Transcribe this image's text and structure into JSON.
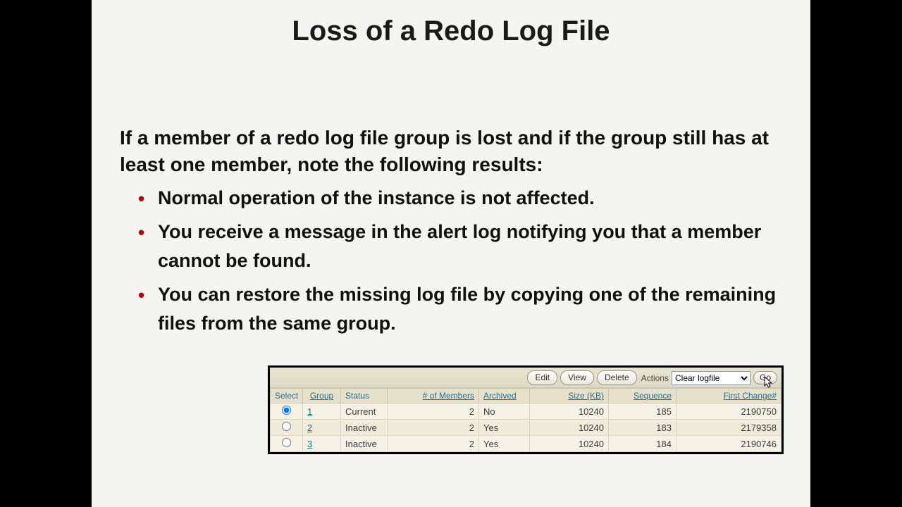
{
  "slide": {
    "title": "Loss of a Redo Log File",
    "intro": "If a member of a redo log file group is lost and if the group still has at least one member, note the following results:",
    "bullets": [
      "Normal operation of the instance is not affected.",
      "You receive a message in the alert log notifying you that a member cannot be found.",
      "You can restore the missing log file by copying one of the remaining files from the same group."
    ]
  },
  "panel": {
    "buttons": {
      "edit": "Edit",
      "view": "View",
      "delete": "Delete",
      "go": "Go"
    },
    "actions_label": "Actions",
    "actions_selected": "Clear logfile",
    "columns": {
      "select": "Select",
      "group": "Group",
      "status": "Status",
      "members": "# of Members",
      "archived": "Archived",
      "size": "Size (KB)",
      "sequence": "Sequence",
      "first_change": "First Change#"
    },
    "rows": [
      {
        "selected": true,
        "group": "1",
        "status": "Current",
        "members": "2",
        "archived": "No",
        "size": "10240",
        "sequence": "185",
        "first_change": "2190750"
      },
      {
        "selected": false,
        "group": "2",
        "status": "Inactive",
        "members": "2",
        "archived": "Yes",
        "size": "10240",
        "sequence": "183",
        "first_change": "2179358"
      },
      {
        "selected": false,
        "group": "3",
        "status": "Inactive",
        "members": "2",
        "archived": "Yes",
        "size": "10240",
        "sequence": "184",
        "first_change": "2190746"
      }
    ]
  }
}
